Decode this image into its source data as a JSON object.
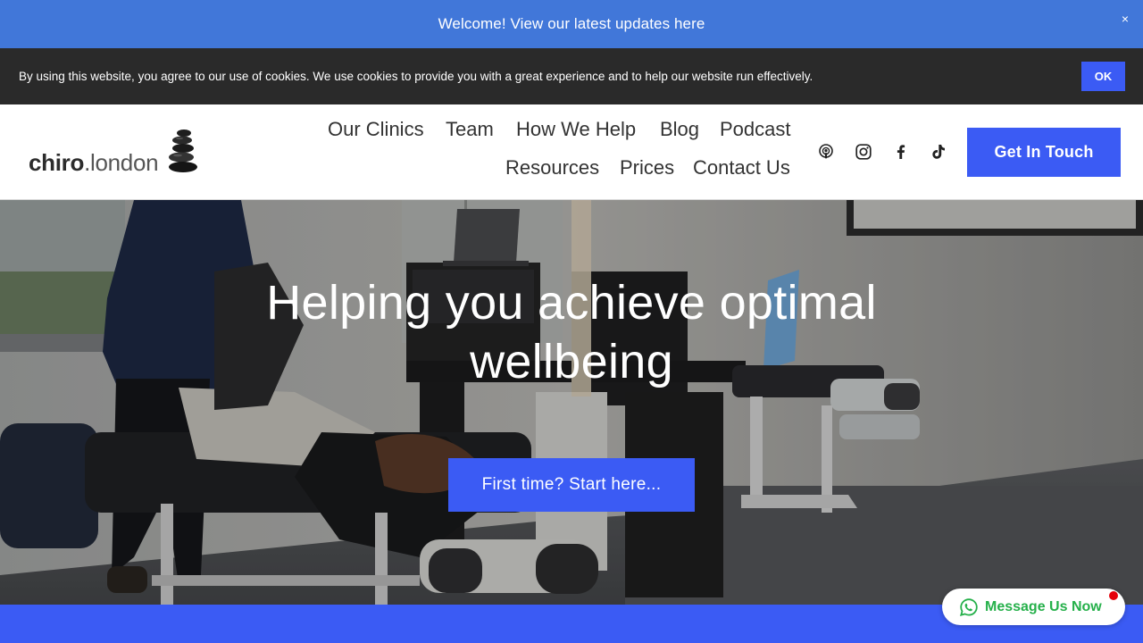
{
  "announcement": {
    "text": "Welcome! View our latest updates here",
    "close_icon": "×"
  },
  "cookie_banner": {
    "text": "By using this website, you agree to our use of cookies. We use cookies to provide you with a great experience and to help our website run effectively.",
    "ok_label": "OK"
  },
  "header": {
    "logo": {
      "brand": "chiro",
      "tld": ".london"
    },
    "nav": {
      "row1": [
        "Our Clinics",
        "Team",
        "How We Help",
        "Blog",
        "Podcast"
      ],
      "row2": [
        "Resources",
        "Prices",
        "Contact Us"
      ]
    },
    "social_icons": [
      "podcast-icon",
      "instagram-icon",
      "facebook-icon",
      "tiktok-icon"
    ],
    "cta_label": "Get In Touch"
  },
  "hero": {
    "title": "Helping you achieve optimal wellbeing",
    "button_label": "First time? Start here..."
  },
  "whatsapp": {
    "label": "Message Us Now",
    "icon": "whatsapp-icon"
  },
  "colors": {
    "announcement_bg": "#4177d9",
    "cookie_bg": "#2a2a2a",
    "accent": "#3b5bf4",
    "whatsapp_green": "#25b04a",
    "notification_red": "#e5000a"
  }
}
